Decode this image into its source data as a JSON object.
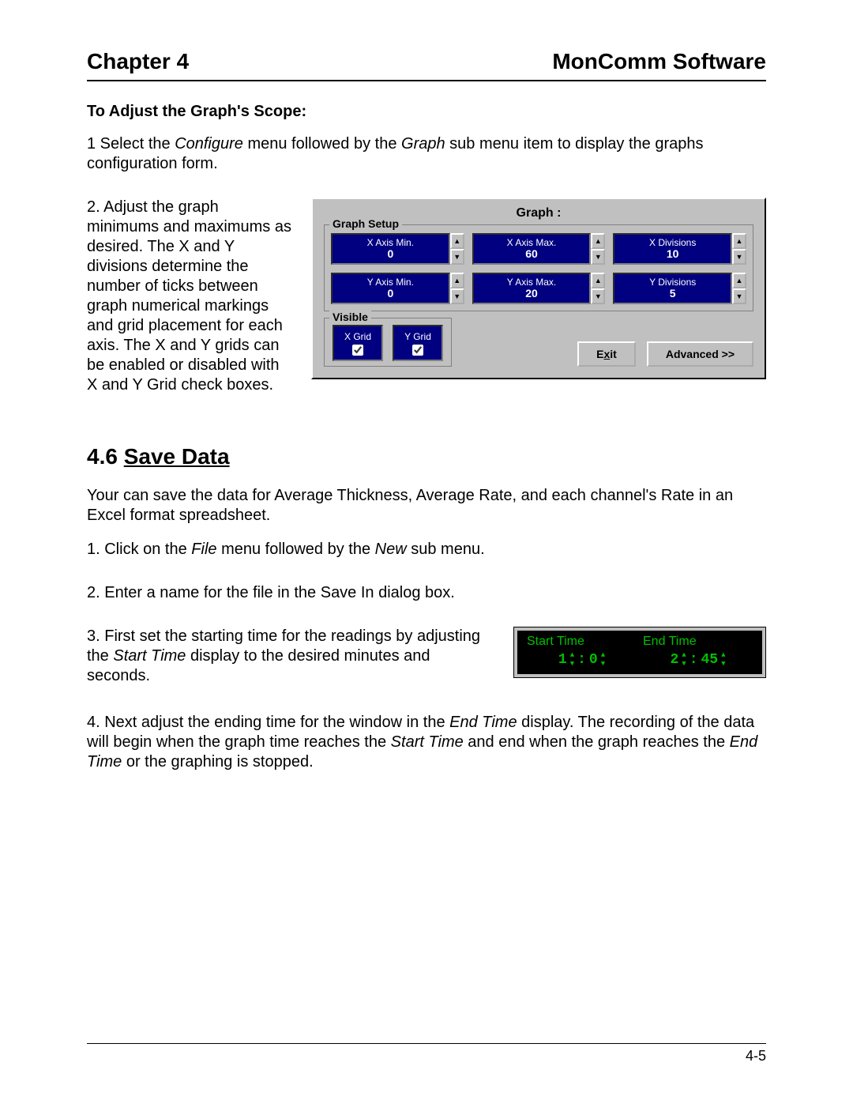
{
  "header": {
    "left": "Chapter 4",
    "right": "MonComm Software"
  },
  "subheading": "To Adjust the Graph's Scope:",
  "para1_a": "1 Select the ",
  "para1_b": "Configure",
  "para1_c": " menu followed by the ",
  "para1_d": "Graph",
  "para1_e": " sub menu item to display the graphs configuration form.",
  "para2": "2.  Adjust the graph minimums and maximums as desired.  The X and Y divisions determine the number of ticks between graph numerical markings and grid placement for each axis. The X and Y grids can be enabled or disabled with X and Y Grid check boxes.",
  "panel": {
    "title": "Graph :",
    "group_legend": "Graph Setup",
    "fields": {
      "xmin": {
        "label": "X Axis Min.",
        "value": "0"
      },
      "xmax": {
        "label": "X Axis Max.",
        "value": "60"
      },
      "xdiv": {
        "label": "X Divisions",
        "value": "10"
      },
      "ymin": {
        "label": "Y Axis Min.",
        "value": "0"
      },
      "ymax": {
        "label": "Y Axis Max.",
        "value": "20"
      },
      "ydiv": {
        "label": "Y Divisions",
        "value": "5"
      }
    },
    "visible_legend": "Visible",
    "xgrid_label": "X Grid",
    "ygrid_label": "Y Grid",
    "exit_pre": "E",
    "exit_ul": "x",
    "exit_post": "it",
    "advanced": "Advanced >>"
  },
  "section": {
    "num": "4.6  ",
    "title": "Save Data"
  },
  "s46_intro": "Your can save the data for Average Thickness, Average Rate, and each channel's Rate in an Excel format spreadsheet.",
  "s46_1a": "1. Click on the ",
  "s46_1b": "File",
  "s46_1c": " menu followed by the ",
  "s46_1d": "New ",
  "s46_1e": "sub menu.",
  "s46_2": "2. Enter a name for the file in the Save In dialog box.",
  "s46_3a": "3. First set the starting time for the readings by adjusting the ",
  "s46_3b": "Start Time",
  "s46_3c": " display to the desired minutes and seconds.",
  "timebox": {
    "start_label": "Start Time",
    "start_min": "1",
    "start_sec": "0",
    "end_label": "End Time",
    "end_min": "2",
    "end_sec": "45"
  },
  "s46_4a": "4. Next adjust the ending time for the window in the ",
  "s46_4b": "End Time",
  "s46_4c": " display. The recording of the data will begin when the graph time reaches the ",
  "s46_4d": "Start Time",
  "s46_4e": " and end when the graph reaches the ",
  "s46_4f": "End Time",
  "s46_4g": " or the graphing is stopped.",
  "footer": "4-5",
  "glyph": {
    "up": "▲",
    "down": "▼",
    "colon": ":"
  }
}
